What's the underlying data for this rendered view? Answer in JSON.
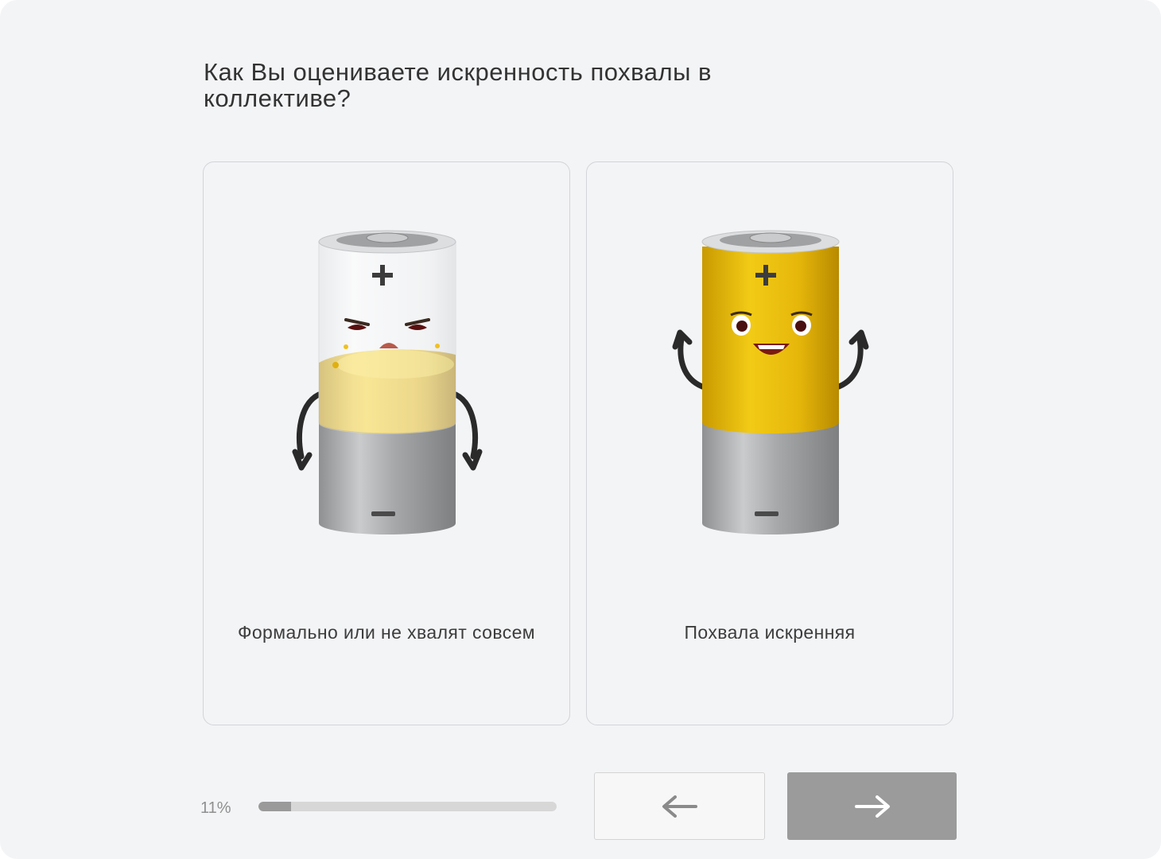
{
  "question": "Как Вы оцениваете искренность похвалы в коллективе?",
  "options": [
    {
      "label": "Формально или не хвалят совсем",
      "icon": "sad-half-battery-icon"
    },
    {
      "label": "Похвала искренняя",
      "icon": "happy-full-battery-icon"
    }
  ],
  "progress": {
    "text": "11%",
    "value": 0.11
  },
  "nav": {
    "back_icon": "arrow-left-icon",
    "next_icon": "arrow-right-icon"
  },
  "colors": {
    "background": "#f3f4f6",
    "progress_fill": "#9a9a9a",
    "next_button": "#9b9b9b",
    "battery_yellow": "#e8be0c"
  }
}
